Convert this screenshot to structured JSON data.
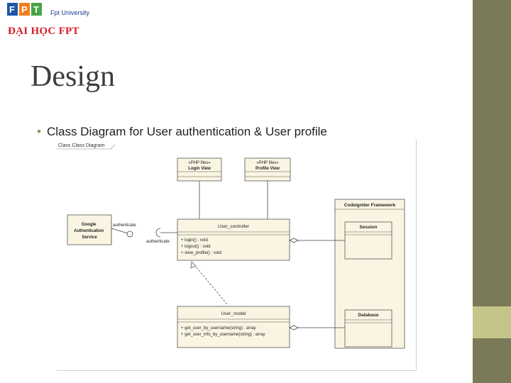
{
  "logo": {
    "brand": "FPT",
    "university": "Fpt University",
    "vietnamese_name": "ĐẠI HỌC FPT"
  },
  "slide": {
    "title": "Design",
    "bullet": "Class Diagram for User authentication & User profile"
  },
  "colors": {
    "accent_bar_dark": "#7a7a58",
    "accent_bar_light": "#c5c58a",
    "class_fill": "#faf5e2",
    "title_text": "#3d3d3d"
  },
  "diagram": {
    "frame_label": "Class Class Diagram",
    "login_view": {
      "stereotype": "«PHP files»",
      "name": "Login View"
    },
    "profile_view": {
      "stereotype": "«PHP files»",
      "name": "Profile View"
    },
    "google_service": {
      "name": "Google Authentication Service"
    },
    "user_controller": {
      "name": "User_controller",
      "methods": [
        "+ login() : void",
        "+ logout() : void",
        "+ view_profile() : void"
      ]
    },
    "user_model": {
      "name": "User_model",
      "methods": [
        "+ get_user_by_username(string) : array",
        "+ get_user_info_by_username(string) : array"
      ]
    },
    "codeigniter": {
      "name": "Codeigniter Framework",
      "session": "Session",
      "database": "Database"
    },
    "labels": {
      "authenticate_top": "authenticate",
      "authenticate_bottom": "authenticate"
    }
  }
}
